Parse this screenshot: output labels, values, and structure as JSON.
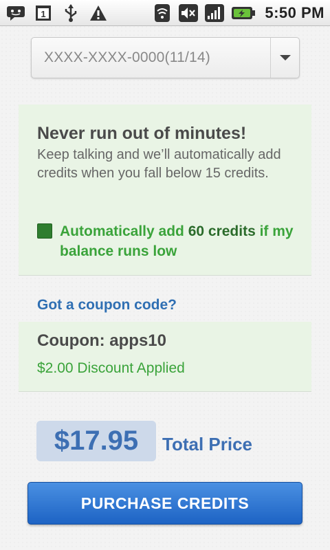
{
  "statusbar": {
    "time": "5:50 PM",
    "left_icons": [
      "notification-icon",
      "calendar-icon",
      "usb-icon",
      "warning-icon"
    ],
    "calendar_day": "1",
    "right_icons": [
      "wifi-icon",
      "mute-icon",
      "signal-icon",
      "battery-icon"
    ]
  },
  "card_select": {
    "value": "XXXX-XXXX-0000(11/14)"
  },
  "autorefill": {
    "title": "Never run out of minutes!",
    "description": "Keep talking and we’ll automatically add credits when you fall below 15 credits.",
    "label_part1": "Automatically add ",
    "credits": "60 credits",
    "label_part2": " if my balance runs low"
  },
  "coupon": {
    "link": "Got a coupon code?",
    "title": "Coupon: apps10",
    "discount": "$2.00 Discount Applied"
  },
  "total": {
    "price": "$17.95",
    "label": "Total Price"
  },
  "purchase": {
    "label": "PURCHASE CREDITS"
  },
  "colors": {
    "accent_blue": "#3d6fb3",
    "button_blue": "#1d63c4",
    "panel_green": "#e9f4e5",
    "text_green": "#3aa33a"
  }
}
